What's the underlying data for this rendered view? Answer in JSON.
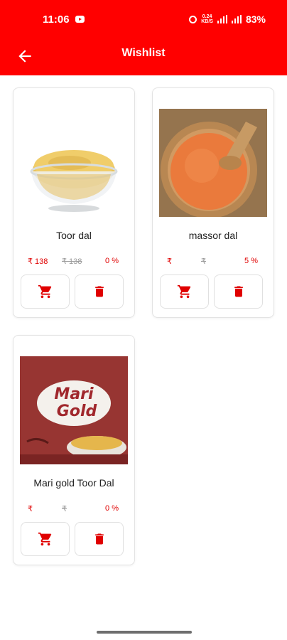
{
  "status_bar": {
    "time": "11:06",
    "speed": "0.24",
    "speed_unit": "KB/S",
    "battery": "83%"
  },
  "app_bar": {
    "title": "Wishlist",
    "back_icon": "arrow-left-icon"
  },
  "colors": {
    "primary": "#ff0000",
    "price_red": "#e00000",
    "mrp_grey": "#9a9a9a"
  },
  "products": [
    {
      "name": "Toor dal",
      "price": "₹ 138",
      "mrp": "₹ 138",
      "discount": "0 %",
      "cart_icon": "cart-icon",
      "delete_icon": "trash-icon"
    },
    {
      "name": "massor dal",
      "price": "₹",
      "mrp": "₹",
      "discount": "5 %",
      "cart_icon": "cart-icon",
      "delete_icon": "trash-icon"
    },
    {
      "name": "Mari gold Toor Dal",
      "price": "₹",
      "mrp": "₹",
      "discount": "0 %",
      "image_brand_text_line1": "Mari",
      "image_brand_text_line2": "Gold",
      "cart_icon": "cart-icon",
      "delete_icon": "trash-icon"
    }
  ]
}
